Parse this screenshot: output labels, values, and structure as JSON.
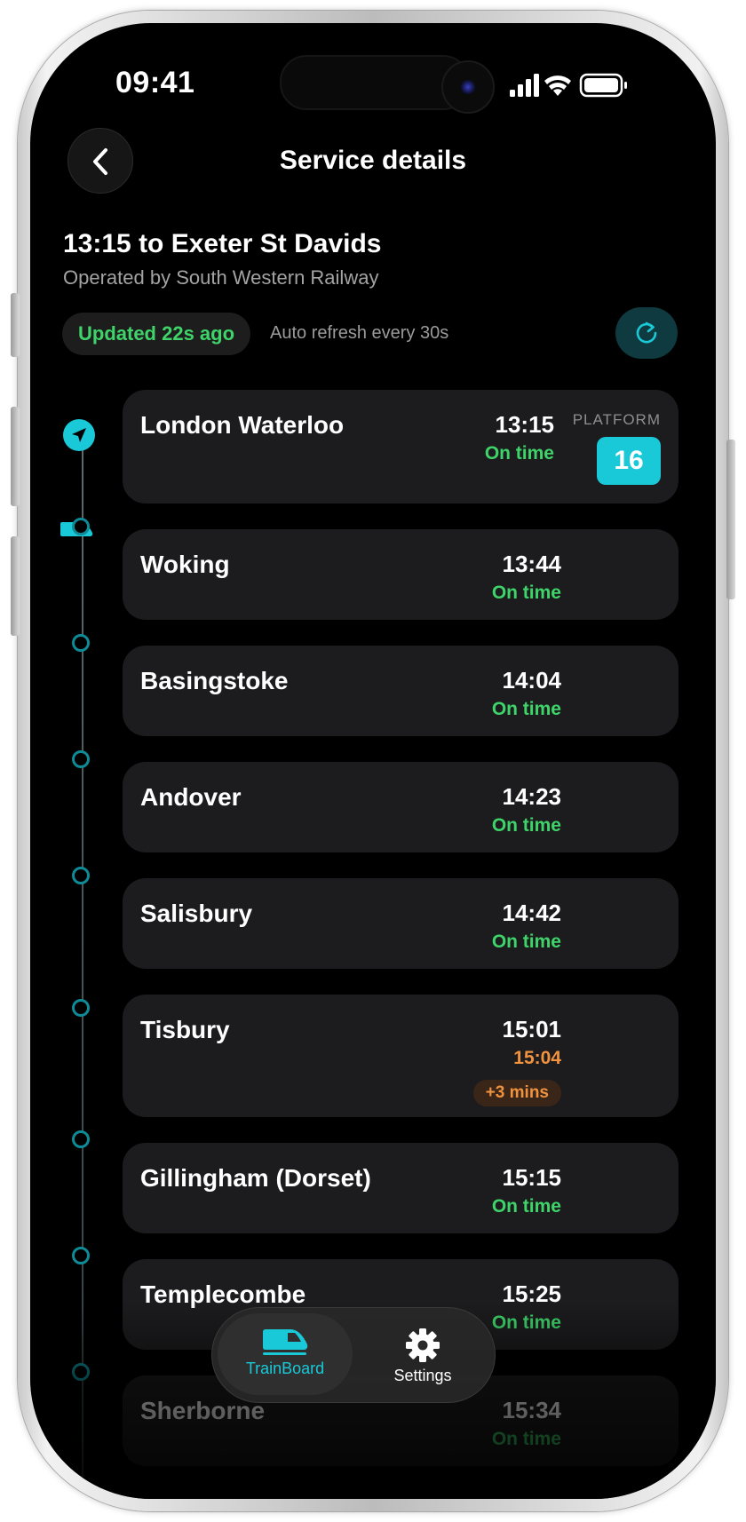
{
  "status_bar": {
    "time": "09:41"
  },
  "nav": {
    "title": "Service details"
  },
  "service": {
    "title": "13:15 to Exeter St Davids",
    "operator": "Operated by South Western Railway",
    "updated": "Updated 22s ago",
    "auto_refresh": "Auto refresh every 30s"
  },
  "platform_label": "PLATFORM",
  "stops": [
    {
      "name": "London Waterloo",
      "time": "13:15",
      "status": "On time",
      "platform": "16"
    },
    {
      "name": "Woking",
      "time": "13:44",
      "status": "On time"
    },
    {
      "name": "Basingstoke",
      "time": "14:04",
      "status": "On time"
    },
    {
      "name": "Andover",
      "time": "14:23",
      "status": "On time"
    },
    {
      "name": "Salisbury",
      "time": "14:42",
      "status": "On time"
    },
    {
      "name": "Tisbury",
      "time": "15:01",
      "status": "15:04",
      "delay": "+3 mins"
    },
    {
      "name": "Gillingham (Dorset)",
      "time": "15:15",
      "status": "On time"
    },
    {
      "name": "Templecombe",
      "time": "15:25",
      "status": "On time"
    },
    {
      "name": "Sherborne",
      "time": "15:34",
      "status": "On time"
    }
  ],
  "tabs": [
    {
      "label": "TrainBoard",
      "icon": "train-icon"
    },
    {
      "label": "Settings",
      "icon": "gear-icon"
    }
  ],
  "colors": {
    "accent": "#19c9d8",
    "on_time": "#3ed46a",
    "late": "#f0923e",
    "card": "#1c1c1e"
  }
}
